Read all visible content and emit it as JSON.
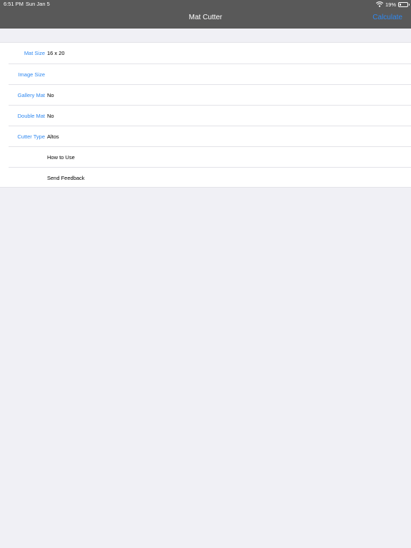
{
  "status_bar": {
    "time": "6:51 PM",
    "date": "Sun Jan 5",
    "battery": "19%",
    "battery_level": 0.19
  },
  "nav": {
    "title": "Mat Cutter",
    "action": "Calculate"
  },
  "settings": {
    "rows": [
      {
        "label": "Mat Size",
        "value": "16 x 20"
      },
      {
        "label": "Image Size",
        "value": ""
      },
      {
        "label": "Gallery Mat",
        "value": "No"
      },
      {
        "label": "Double Mat",
        "value": "No"
      },
      {
        "label": "Cutter Type",
        "value": "Altos"
      },
      {
        "label": "",
        "value": "How to Use"
      },
      {
        "label": "",
        "value": "Send Feedback"
      }
    ]
  },
  "colors": {
    "nav_background": "#595959",
    "accent": "#2f88f0",
    "page_background": "#f0f0f5",
    "separator": "#e3e3e8"
  },
  "icons": {
    "wifi": "wifi-icon",
    "battery": "battery-icon"
  }
}
